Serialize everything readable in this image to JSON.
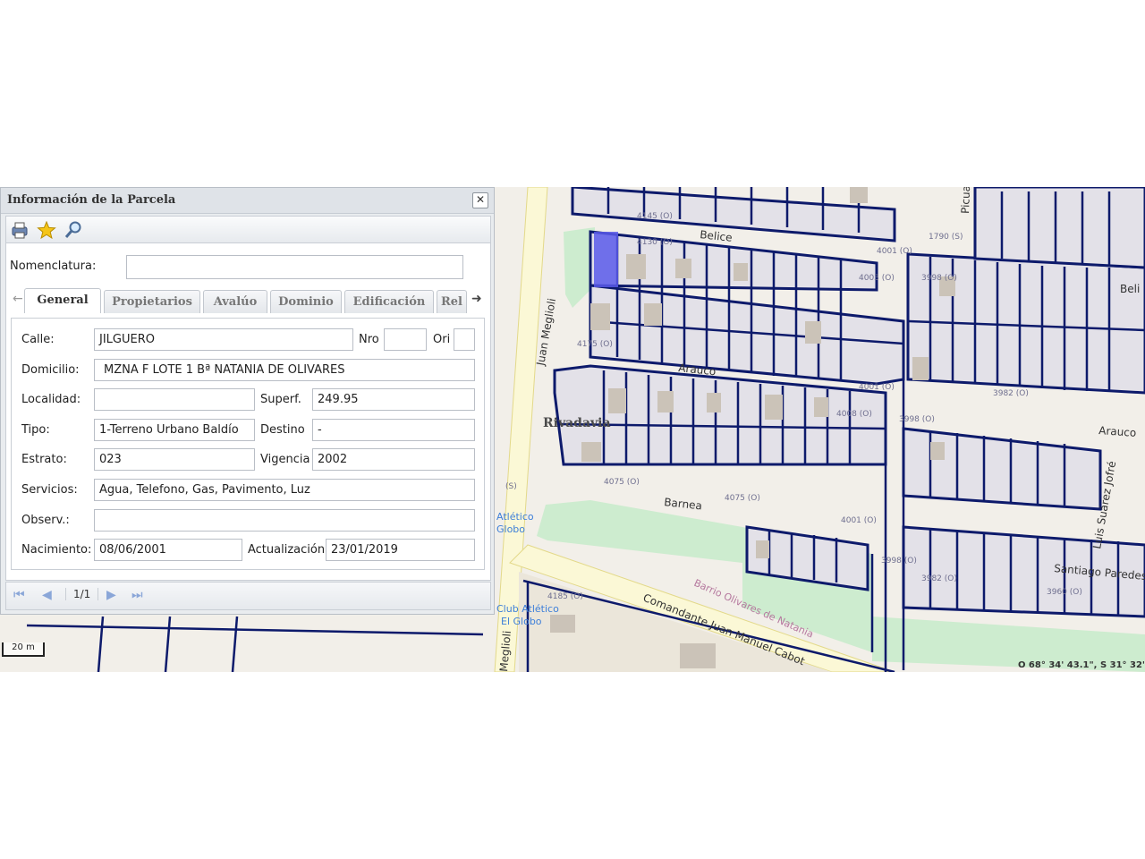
{
  "panel": {
    "title": "Información de la Parcela",
    "close_label": "✕",
    "nomenclatura_label": "Nomenclatura:",
    "nomenclatura_value": "",
    "tabs": [
      "General",
      "Propietarios",
      "Avalúo",
      "Dominio",
      "Edificación",
      "Rel"
    ],
    "active_tab": "General",
    "fields": {
      "calle_label": "Calle:",
      "calle": "JILGUERO",
      "nro_label": "Nro",
      "nro": "",
      "ori_label": "Ori",
      "ori": "",
      "domicilio_label": "Domicilio:",
      "domicilio": "MZNA F LOTE 1  Bª NATANIA DE OLIVARES",
      "localidad_label": "Localidad:",
      "localidad": "",
      "superf_label": "Superf.",
      "superf": "249.95",
      "tipo_label": "Tipo:",
      "tipo": "1-Terreno Urbano Baldío",
      "destino_label": "Destino",
      "destino": "-",
      "estrato_label": "Estrato:",
      "estrato": "023",
      "vigencia_label": "Vigencia",
      "vigencia": "2002",
      "servicios_label": "Servicios:",
      "servicios": "Agua, Telefono, Gas, Pavimento, Luz",
      "observ_label": "Observ.:",
      "observ": "",
      "nacimiento_label": "Nacimiento:",
      "nacimiento": "08/06/2001",
      "actualizacion_label": "Actualización",
      "actualizacion": "23/01/2019"
    },
    "pager": {
      "text": "1/1"
    }
  },
  "map": {
    "streets": [
      "Belice",
      "Arauco",
      "Barnea",
      "Juan Meglioli",
      "Comandante Juan Manuel Cabot",
      "Luis Suárez Jofré",
      "Santiago Paredes",
      "Picua"
    ],
    "neighborhood": "Rivadavia",
    "park_label": "Barrio Olivares de Natania",
    "poi": [
      "Club Atlético El Globo"
    ],
    "house_numbers": [
      "4145 (O)",
      "4130 (O)",
      "4001 (O)",
      "3991 (O)",
      "3998 (O)",
      "4175 (O)",
      "4001 (O)",
      "3998 (O)",
      "4075 (O)",
      "4001 (O)",
      "4185 (O)",
      "3998 (O)",
      "3982 (O)"
    ],
    "coordinates": "O 68° 34' 43.1\", S 31° 32'",
    "scale": "20 m",
    "colors": {
      "parcel_line": "#0d1a6b",
      "highlight": "#5b5bea",
      "park": "#cdeccf",
      "road": "#fbf8d6",
      "building": "#cbc3b8"
    }
  }
}
